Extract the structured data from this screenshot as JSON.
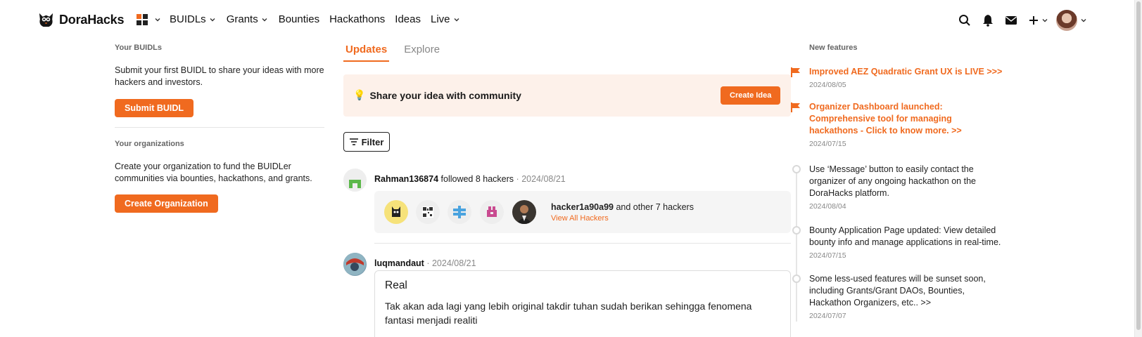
{
  "brand": {
    "name": "DoraHacks"
  },
  "nav": {
    "links": [
      {
        "label": "BUIDLs",
        "has_menu": true
      },
      {
        "label": "Grants",
        "has_menu": true
      },
      {
        "label": "Bounties",
        "has_menu": false
      },
      {
        "label": "Hackathons",
        "has_menu": false
      },
      {
        "label": "Ideas",
        "has_menu": false
      },
      {
        "label": "Live",
        "has_menu": true
      }
    ],
    "icons": [
      "search-icon",
      "bell-icon",
      "mail-icon",
      "plus-icon"
    ]
  },
  "left": {
    "buidls_title": "Your BUIDLs",
    "buidls_text": "Submit your first BUIDL to share your ideas with more hackers and investors.",
    "submit_label": "Submit BUIDL",
    "orgs_title": "Your organizations",
    "orgs_text": "Create your organization to fund the BUIDLer communities via bounties, hackathons, and grants.",
    "create_org_label": "Create Organization"
  },
  "center": {
    "tabs": [
      {
        "label": "Updates",
        "active": true
      },
      {
        "label": "Explore",
        "active": false
      }
    ],
    "share": {
      "emoji": "💡",
      "text": "Share your idea with community",
      "button": "Create Idea"
    },
    "filter_label": "Filter",
    "feed": [
      {
        "user": "Rahman136874",
        "action": "followed 8 hackers",
        "date": "2024/08/21",
        "hacker_name": "hacker1a90a99",
        "hacker_suffix": "and other 7 hackers",
        "view_all": "View All Hackers"
      },
      {
        "user": "luqmandaut",
        "date": "2024/08/21",
        "post_title": "Real",
        "post_body": "Tak akan ada lagi yang lebih original takdir tuhan sudah berikan sehingga fenomena fantasi menjadi realiti"
      }
    ]
  },
  "right": {
    "title": "New features",
    "features": [
      {
        "text": "Improved AEZ Quadratic Grant UX is LIVE >>>",
        "date": "2024/08/05",
        "highlight": true
      },
      {
        "text": "Organizer Dashboard launched: Comprehensive tool for managing hackathons - Click to know more. >>",
        "date": "2024/07/15",
        "highlight": true
      },
      {
        "text": "Use ‘Message’ button to easily contact the organizer of any ongoing hackathon on the DoraHacks platform.",
        "date": "2024/08/04",
        "highlight": false
      },
      {
        "text": "Bounty Application Page updated: View detailed bounty info and manage applications in real-time.",
        "date": "2024/07/15",
        "highlight": false
      },
      {
        "text": "Some less-used features will be sunset soon, including Grants/Grant DAOs, Bounties, Hackathon Organizers, etc.. >>",
        "date": "2024/07/07",
        "highlight": false
      }
    ]
  },
  "colors": {
    "accent": "#f06a1f",
    "share_bg": "#fdf1ea"
  }
}
